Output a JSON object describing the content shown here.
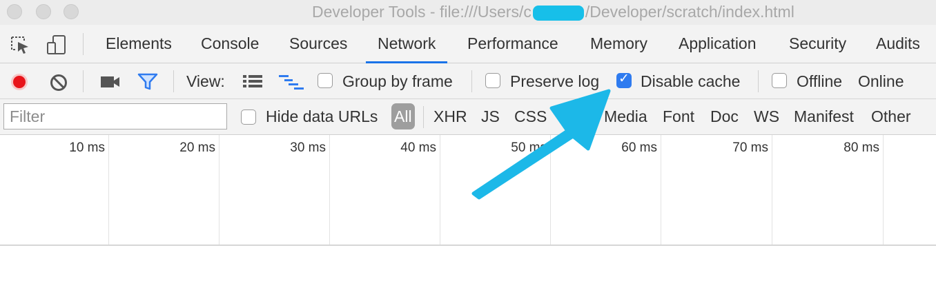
{
  "window": {
    "title_prefix": "Developer Tools - file:///Users/c",
    "title_suffix": "/Developer/scratch/index.html"
  },
  "tabs": [
    {
      "label": "Elements"
    },
    {
      "label": "Console"
    },
    {
      "label": "Sources"
    },
    {
      "label": "Network",
      "active": true
    },
    {
      "label": "Performance"
    },
    {
      "label": "Memory"
    },
    {
      "label": "Application"
    },
    {
      "label": "Security"
    },
    {
      "label": "Audits"
    }
  ],
  "toolbar": {
    "view_label": "View:",
    "group_by_frame": {
      "label": "Group by frame",
      "checked": false
    },
    "preserve_log": {
      "label": "Preserve log",
      "checked": false
    },
    "disable_cache": {
      "label": "Disable cache",
      "checked": true
    },
    "offline": {
      "label": "Offline",
      "checked": false
    },
    "throttle_label": "Online"
  },
  "filterbar": {
    "placeholder": "Filter",
    "hide_data_urls": {
      "label": "Hide data URLs",
      "checked": false
    },
    "types": [
      "All",
      "XHR",
      "JS",
      "CSS",
      "Img",
      "Media",
      "Font",
      "Doc",
      "WS",
      "Manifest",
      "Other"
    ]
  },
  "timeline": {
    "ticks": [
      "10 ms",
      "20 ms",
      "30 ms",
      "40 ms",
      "50 ms",
      "60 ms",
      "70 ms",
      "80 ms"
    ]
  },
  "colors": {
    "accent": "#1a73e8",
    "record": "#e8141a",
    "filter_icon": "#2f7bef",
    "annotation_arrow": "#1cb8e8"
  },
  "icons": [
    "inspect-element-icon",
    "device-toolbar-icon",
    "record-icon",
    "clear-icon",
    "screenshot-camera-icon",
    "filter-icon",
    "list-view-icon",
    "waterfall-view-icon"
  ]
}
